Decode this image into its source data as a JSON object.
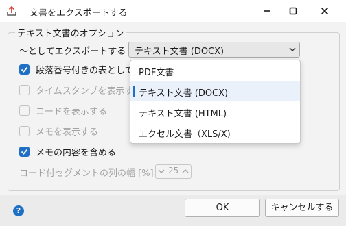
{
  "window": {
    "title": "文書をエクスポートする",
    "icon": "export-icon",
    "controls": [
      "minimize-icon",
      "maximize-icon",
      "close-icon"
    ]
  },
  "options_group": {
    "title": "テキスト文書のオプション",
    "export_as_label": "〜としてエクスポートする",
    "export_as_value": "テキスト文書 (DOCX)",
    "checkboxes": [
      {
        "label": "段落番号付きの表として",
        "checked": true,
        "enabled": true
      },
      {
        "label": "タイムスタンプを表示す",
        "checked": false,
        "enabled": false
      },
      {
        "label": "コードを表示する",
        "checked": false,
        "enabled": false
      },
      {
        "label": "メモを表示する",
        "checked": false,
        "enabled": false
      },
      {
        "label": "メモの内容を含める",
        "checked": true,
        "enabled": true
      }
    ],
    "column_width_label": "コード付セグメントの列の幅 [%]",
    "column_width_value": "25"
  },
  "dropdown": {
    "options": [
      "PDF文書",
      "テキスト文書 (DOCX)",
      "テキスト文書 (HTML)",
      "エクセル文書（XLS/X)"
    ],
    "selected_index": 1
  },
  "footer": {
    "help": "?",
    "ok_label": "OK",
    "cancel_label": "キャンセルする"
  },
  "colors": {
    "accent": "#1f6fc5",
    "background": "#f3f3f3",
    "disabled_text": "#a3a3a3"
  }
}
